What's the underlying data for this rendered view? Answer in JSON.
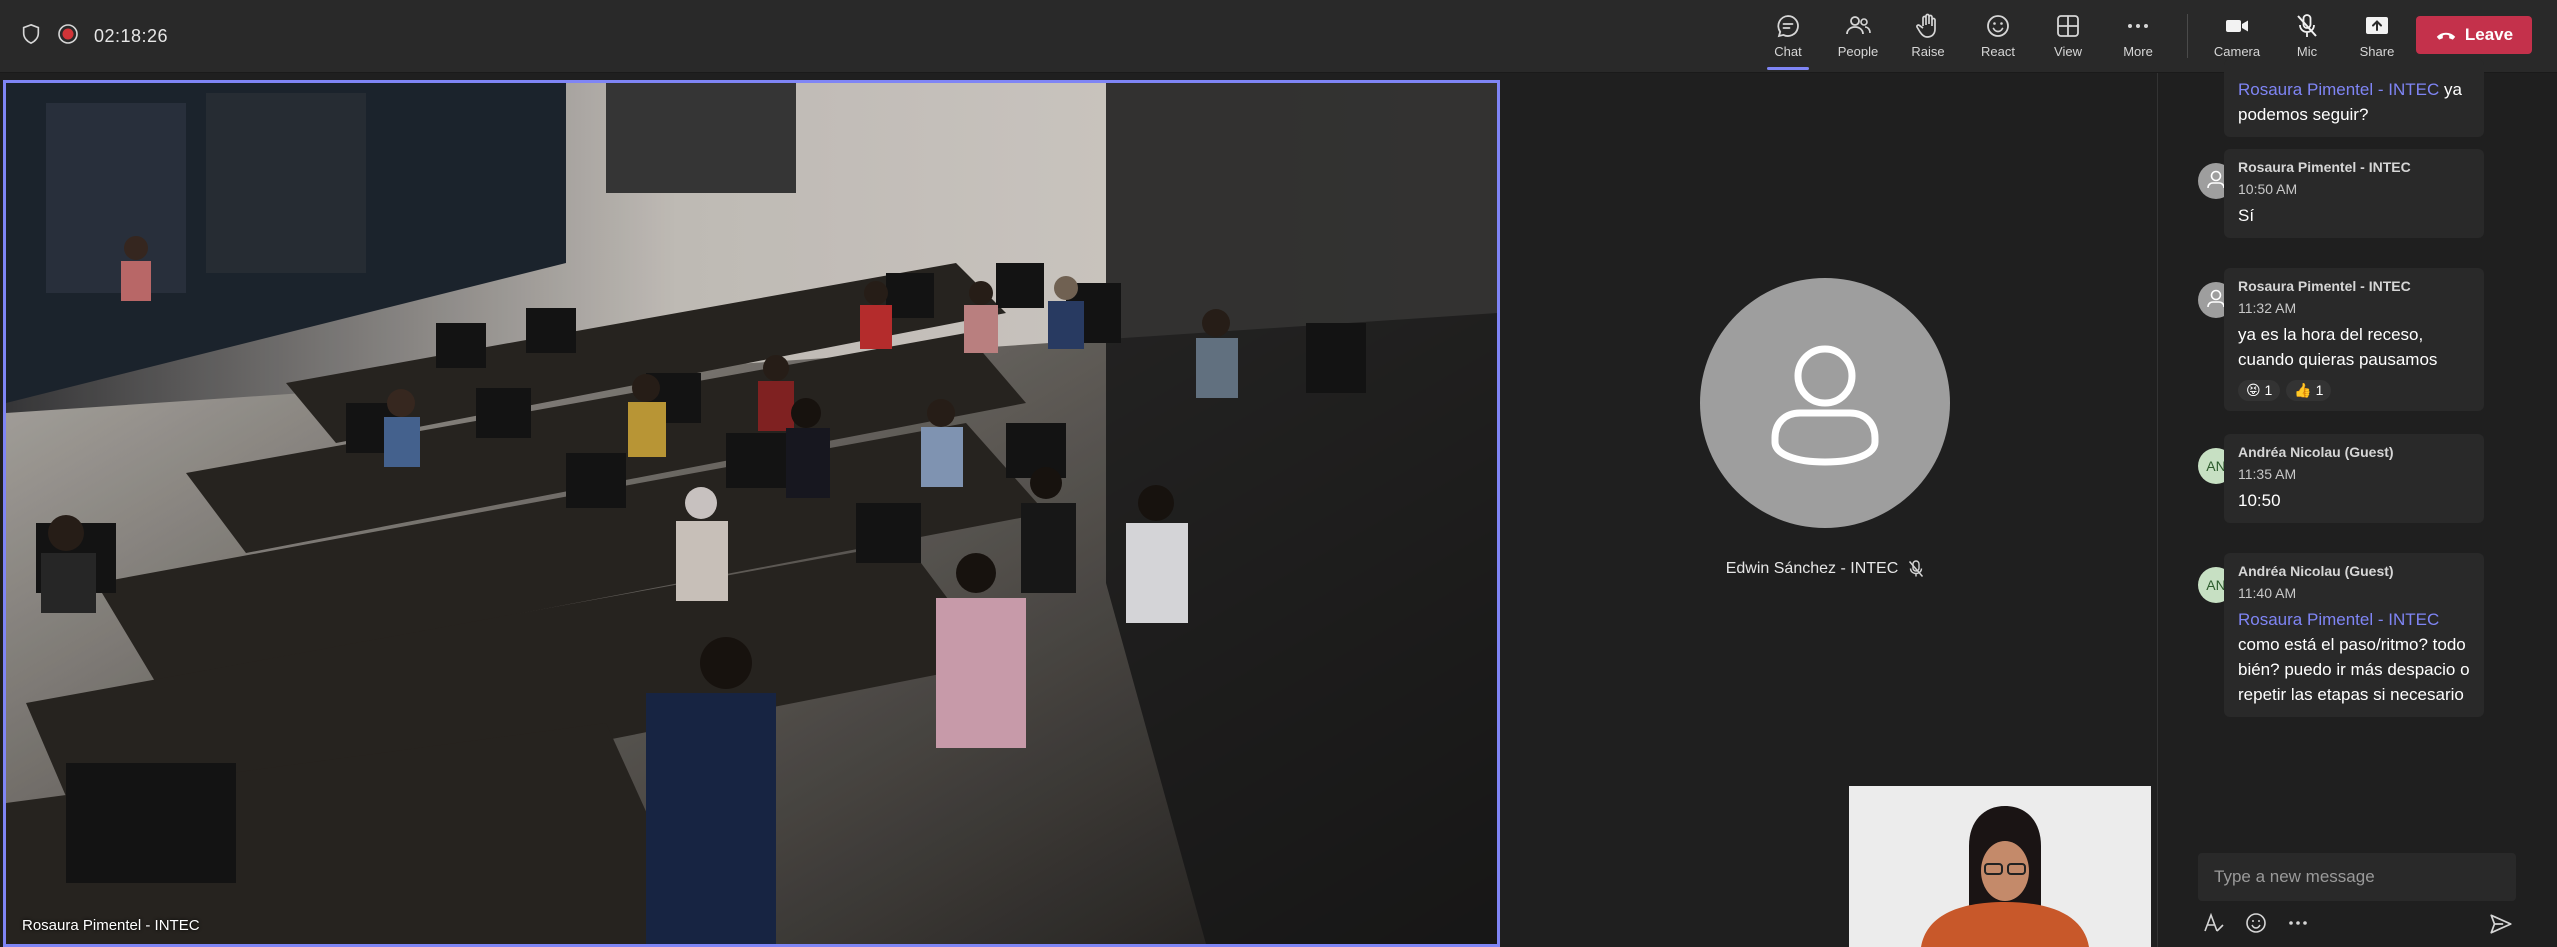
{
  "topbar": {
    "timer": "02:18:26",
    "controls": [
      {
        "label": "Chat",
        "icon": "chat-icon"
      },
      {
        "label": "People",
        "icon": "people-icon"
      },
      {
        "label": "Raise",
        "icon": "raise-hand-icon"
      },
      {
        "label": "React",
        "icon": "smiley-icon"
      },
      {
        "label": "View",
        "icon": "grid-icon"
      },
      {
        "label": "More",
        "icon": "more-icon"
      }
    ],
    "media": [
      {
        "label": "Camera",
        "icon": "camera-icon"
      },
      {
        "label": "Mic",
        "icon": "mic-off-icon"
      },
      {
        "label": "Share",
        "icon": "share-icon"
      }
    ],
    "leave_label": "Leave",
    "accent": "#7f85f5",
    "leave_color": "#c4314b"
  },
  "main_video": {
    "name": "Rosaura Pimentel - INTEC"
  },
  "participant": {
    "name": "Edwin Sánchez - INTEC"
  },
  "chat": {
    "messages": [
      {
        "mention": "Rosaura Pimentel - INTEC",
        "text": " ya podemos seguir?"
      },
      {
        "author": "Rosaura Pimentel - INTEC",
        "time": "10:50 AM",
        "text": "Sí"
      },
      {
        "author": "Rosaura Pimentel - INTEC",
        "time": "11:32 AM",
        "text": "ya es la hora del receso, cuando quieras pausamos",
        "reactions": [
          {
            "emoji": "😝",
            "count": "1"
          },
          {
            "emoji": "👍",
            "count": "1"
          }
        ]
      },
      {
        "author": "Andréa Nicolau (Guest)",
        "initials": "AN",
        "time": "11:35 AM",
        "text": "10:50"
      },
      {
        "author": "Andréa Nicolau (Guest)",
        "initials": "AN",
        "time": "11:40 AM",
        "mention": "Rosaura Pimentel - INTEC",
        "text": " como está el paso/ritmo? todo bién? puedo ir más despacio o repetir las etapas si necesario"
      }
    ],
    "compose_placeholder": "Type a new message"
  }
}
